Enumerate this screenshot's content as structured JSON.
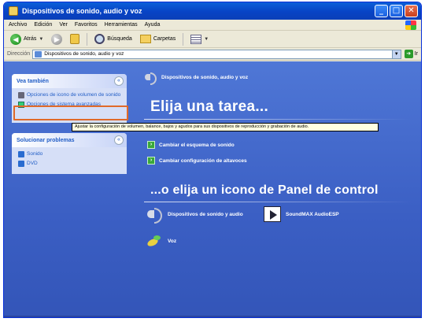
{
  "window": {
    "title": "Dispositivos de sonido, audio y voz",
    "buttons": {
      "minimize": "_",
      "maximize": "□",
      "close": "✕"
    }
  },
  "menu": [
    "Archivo",
    "Edición",
    "Ver",
    "Favoritos",
    "Herramientas",
    "Ayuda"
  ],
  "toolbar": {
    "back": "Atrás",
    "search": "Búsqueda",
    "folders": "Carpetas"
  },
  "address": {
    "label": "Dirección",
    "value": "Dispositivos de sonido, audio y voz",
    "go": "Ir"
  },
  "see_also": {
    "title": "Vea también",
    "items": [
      "Opciones de icono de volumen de sonido",
      "Opciones de sistema avanzadas"
    ]
  },
  "troubleshoot": {
    "title": "Solucionar problemas",
    "items": [
      "Sonido",
      "DVD"
    ]
  },
  "tooltip": "Ajustar la configuración de volumen, balance, bajos y agudos para sus dispositivos de reproducción y grabación de audio.",
  "main": {
    "header": "Dispositivos de sonido, audio y voz",
    "pick_task": "Elija una tarea...",
    "tasks": [
      "Cambiar el esquema de sonido",
      "Cambiar configuración de altavoces"
    ],
    "pick_icon": "...o elija un icono de Panel de control",
    "icons": [
      {
        "label": "Dispositivos de sonido y audio",
        "icon": "speaker-icon"
      },
      {
        "label": "SoundMAX AudioESP",
        "icon": "play-icon"
      },
      {
        "label": "Voz",
        "icon": "voice-icon"
      }
    ]
  },
  "colors": {
    "content_bg": "#3b5fc4",
    "title_bar": "#0843c5",
    "panel_bg": "#d6dff7",
    "link": "#215dc6",
    "highlight": "#e06a2a",
    "tooltip_bg": "#ffffe1"
  }
}
